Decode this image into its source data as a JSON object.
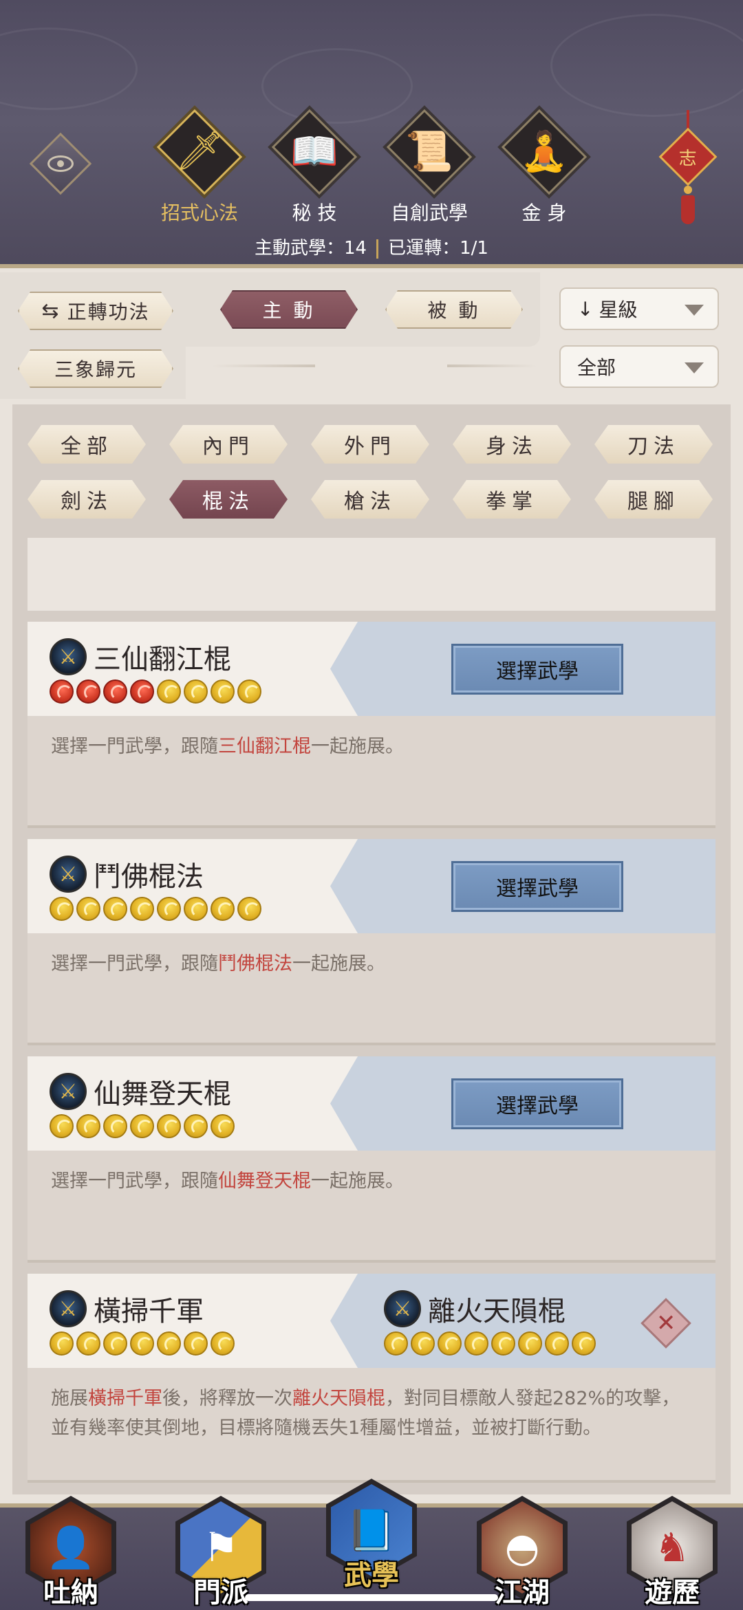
{
  "header": {
    "tabs": [
      {
        "label": "招式心法",
        "icon": "sword-icon",
        "glyph": "🗡",
        "active": true
      },
      {
        "label": "秘 技",
        "icon": "book-icon",
        "glyph": "📖",
        "active": false
      },
      {
        "label": "自創武學",
        "icon": "scroll-icon",
        "glyph": "📜",
        "active": false
      },
      {
        "label": "金 身",
        "icon": "meditation-icon",
        "glyph": "🧘",
        "active": false
      }
    ],
    "stats_active_label": "主動武學：14",
    "stats_running_label": "已運轉：1/1",
    "lantern_char": "志"
  },
  "controls": {
    "switch_label": "正轉功法",
    "mode_active": "主 動",
    "mode_passive": "被 動",
    "sort_label": "星級",
    "filter_label": "全部",
    "extra_label": "三象歸元"
  },
  "categories": [
    "全部",
    "內門",
    "外門",
    "身法",
    "刀法",
    "劍法",
    "棍法",
    "槍法",
    "拳掌",
    "腿腳"
  ],
  "active_category_index": 6,
  "select_button_label": "選擇武學",
  "cards": [
    {
      "name": "三仙翻江棍",
      "red_stars": 4,
      "gold_stars": 4,
      "desc_prefix": "選擇一門武學，跟隨",
      "desc_highlight": "三仙翻江棍",
      "desc_suffix": "一起施展。"
    },
    {
      "name": "鬥佛棍法",
      "red_stars": 0,
      "gold_stars": 8,
      "desc_prefix": "選擇一門武學，跟隨",
      "desc_highlight": "鬥佛棍法",
      "desc_suffix": "一起施展。"
    },
    {
      "name": "仙舞登天棍",
      "red_stars": 0,
      "gold_stars": 7,
      "desc_prefix": "選擇一門武學，跟隨",
      "desc_highlight": "仙舞登天棍",
      "desc_suffix": "一起施展。"
    }
  ],
  "combo_card": {
    "name": "橫掃千軍",
    "stars": 7,
    "linked_name": "離火天隕棍",
    "linked_stars": 8,
    "desc_part1": "施展",
    "desc_hl1": "橫掃千軍",
    "desc_part2": "後，將釋放一次",
    "desc_hl2": "離火天隕棍",
    "desc_part3": "，對同目標敵人發起282%的攻擊，並有幾率使其倒地，目標將隨機丟失1種屬性增益，並被打斷行動。"
  },
  "bottom_nav": [
    {
      "label": "吐納",
      "icon": "monk-icon",
      "color": "#7a3020",
      "active": false
    },
    {
      "label": "門派",
      "icon": "sect-icon",
      "color": "#3f64b0",
      "active": false
    },
    {
      "label": "武學",
      "icon": "manual-icon",
      "color": "#3a68b8",
      "active": true
    },
    {
      "label": "江湖",
      "icon": "straw-hat-icon",
      "color": "#8a2c24",
      "active": false
    },
    {
      "label": "遊歷",
      "icon": "horse-icon",
      "color": "#d9d2cc",
      "active": false
    }
  ]
}
